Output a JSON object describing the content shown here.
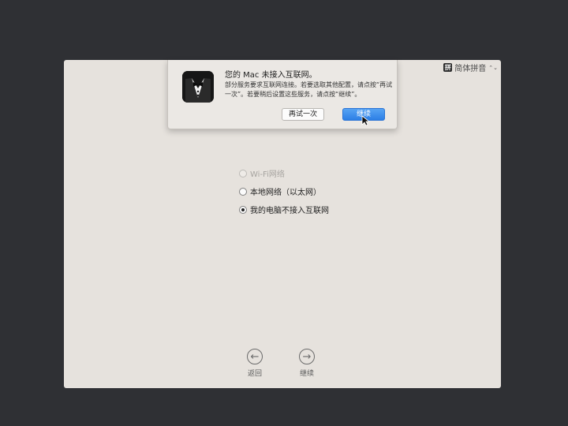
{
  "input_menu": {
    "icon_glyph": "拼",
    "label": "简体拼音",
    "chevron": "⌃⌄"
  },
  "dialog": {
    "title": "您的 Mac 未接入互联网。",
    "message": "部分服务要求互联网连接。若要选取其他配置，请点按“再试一次”。若要稍后设置这些服务，请点按“继续”。",
    "retry_label": "再试一次",
    "continue_label": "继续"
  },
  "options": [
    {
      "label": "Wi-Fi网络",
      "disabled": true,
      "checked": false
    },
    {
      "label": "本地网络（以太网）",
      "disabled": false,
      "checked": false
    },
    {
      "label": "我的电脑不接入互联网",
      "disabled": false,
      "checked": true
    }
  ],
  "nav": {
    "back_label": "返回",
    "continue_label": "继续"
  }
}
